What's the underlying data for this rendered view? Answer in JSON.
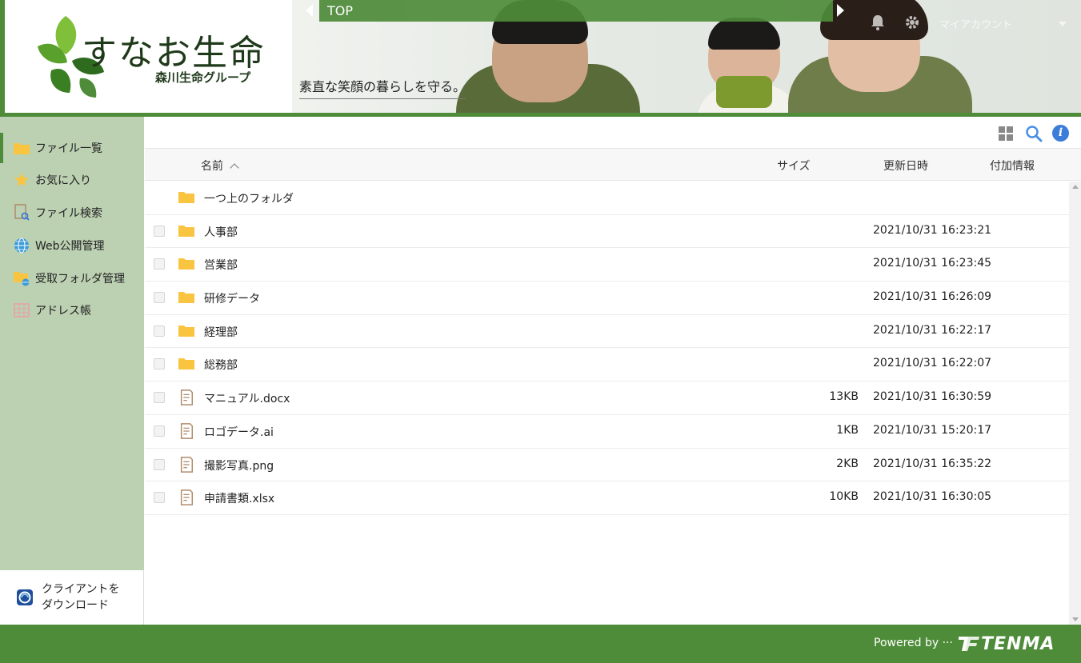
{
  "brand": {
    "name": "すなお生命",
    "group": "森川生命グループ",
    "tagline": "素直な笑顔の暮らしを守る。"
  },
  "topnav": {
    "breadcrumb": "TOP",
    "account_label": "マイアカウント"
  },
  "sidebar": {
    "items": [
      {
        "label": "ファイル一覧",
        "icon": "folder-icon"
      },
      {
        "label": "お気に入り",
        "icon": "star-icon"
      },
      {
        "label": "ファイル検索",
        "icon": "file-search-icon"
      },
      {
        "label": "Web公開管理",
        "icon": "globe-icon"
      },
      {
        "label": "受取フォルダ管理",
        "icon": "folder-globe-icon"
      },
      {
        "label": "アドレス帳",
        "icon": "address-book-icon"
      }
    ],
    "client_download": {
      "line1": "クライアントを",
      "line2": "ダウンロード"
    }
  },
  "table": {
    "headers": {
      "name": "名前",
      "size": "サイズ",
      "updated": "更新日時",
      "extra": "付加情報"
    },
    "parent_folder": "一つ上のフォルダ",
    "rows": [
      {
        "name": "人事部",
        "type": "folder",
        "size": "",
        "date": "2021/10/31 16:23:21"
      },
      {
        "name": "営業部",
        "type": "folder",
        "size": "",
        "date": "2021/10/31 16:23:45"
      },
      {
        "name": "研修データ",
        "type": "folder",
        "size": "",
        "date": "2021/10/31 16:26:09"
      },
      {
        "name": "経理部",
        "type": "folder",
        "size": "",
        "date": "2021/10/31 16:22:17"
      },
      {
        "name": "総務部",
        "type": "folder",
        "size": "",
        "date": "2021/10/31 16:22:07"
      },
      {
        "name": "マニュアル.docx",
        "type": "file",
        "size": "13KB",
        "date": "2021/10/31 16:30:59"
      },
      {
        "name": "ロゴデータ.ai",
        "type": "file",
        "size": "1KB",
        "date": "2021/10/31 15:20:17"
      },
      {
        "name": "撮影写真.png",
        "type": "file",
        "size": "2KB",
        "date": "2021/10/31 16:35:22"
      },
      {
        "name": "申請書類.xlsx",
        "type": "file",
        "size": "10KB",
        "date": "2021/10/31 16:30:05"
      }
    ]
  },
  "footer": {
    "powered_by": "Powered by ···",
    "brand": "TENMA"
  },
  "colors": {
    "accent": "#4e8c3a",
    "sidebar_bg": "#bcd0b2",
    "folder": "#f9c440",
    "file_icon": "#b08b6a",
    "info_blue": "#3b7dd8"
  }
}
